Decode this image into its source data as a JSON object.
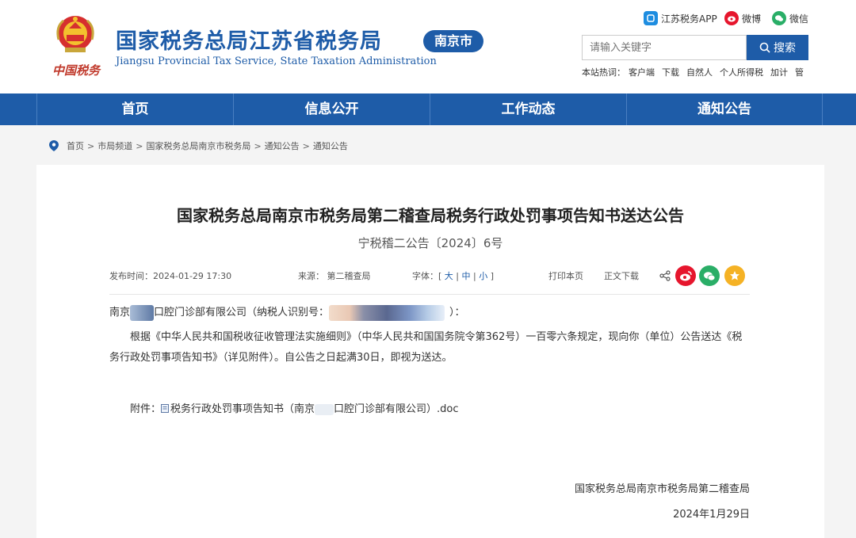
{
  "header": {
    "slogan": "中国税务",
    "site_title": "国家税务总局江苏省税务局",
    "city_badge": "南京市",
    "site_subtitle": "Jiangsu Provincial Tax Service, State Taxation Administration",
    "social": {
      "app": "江苏税务APP",
      "weibo": "微博",
      "wechat": "微信"
    },
    "search": {
      "placeholder": "请输入关键字",
      "button": "搜索"
    },
    "hot": {
      "label": "本站热词：",
      "items": [
        "客户端",
        "下载",
        "自然人",
        "个人所得税",
        "加计",
        "管"
      ]
    }
  },
  "nav": {
    "items": [
      "首页",
      "信息公开",
      "工作动态",
      "通知公告"
    ]
  },
  "breadcrumb": [
    "首页",
    "市局频道",
    "国家税务总局南京市税务局",
    "通知公告",
    "通知公告"
  ],
  "article": {
    "title": "国家税务总局南京市税务局第二稽查局税务行政处罚事项告知书送达公告",
    "doc_no": "宁税稽二公告〔2024〕6号",
    "meta": {
      "date_label": "发布时间：2024-01-29 17:30",
      "source_label": "来源： 第二稽查局",
      "font_label": "字体：",
      "font_large": "大",
      "font_medium": "中",
      "font_small": "小",
      "print": "打印本页",
      "download": "正文下载"
    },
    "addressee_prefix": "南京",
    "addressee_mid": "口腔门诊部有限公司（纳税人识别号：",
    "addressee_suffix": "）：",
    "paragraph": "根据《中华人民共和国税收征收管理法实施细则》（中华人民共和国国务院令第362号）一百零六条规定，现向你（单位）公告送达《税务行政处罚事项告知书》（详见附件）。自公告之日起满30日，即视为送达。",
    "attachment_label": "附件：",
    "attachment_pre": "税务行政处罚事项告知书（南京",
    "attachment_post": "口腔门诊部有限公司）.doc",
    "signer": "国家税务总局南京市税务局第二稽查局",
    "sign_date": "2024年1月29日"
  },
  "colors": {
    "brand_blue": "#1e5ca8",
    "weibo_red": "#e6162d",
    "wechat_green": "#2aae67",
    "favorite_gold": "#f5b225"
  }
}
